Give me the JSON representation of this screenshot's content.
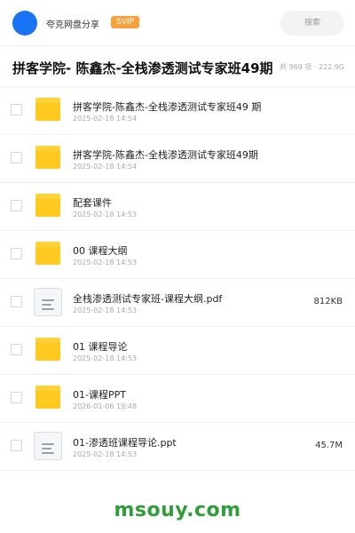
{
  "header": {
    "share_name": "夸克网盘分享",
    "badge": "SVIP",
    "search_label": "搜索",
    "colors": {
      "avatar": "#1a73f5",
      "badge": "#f9a23c"
    }
  },
  "share": {
    "title": "拼客学院- 陈鑫杰-全栈渗透测试专家班49期",
    "meta": "共 969 项 · 222.9G"
  },
  "files": [
    {
      "type": "folder",
      "icon": "folder-icon",
      "name": "拼客学院-陈鑫杰-全栈渗透测试专家班49 期",
      "date": "2025-02-18 14:54",
      "size": ""
    },
    {
      "type": "folder",
      "icon": "folder-icon",
      "name": "拼客学院-陈鑫杰-全栈渗透测试专家班49期",
      "date": "2025-02-18 14:54",
      "size": ""
    },
    {
      "type": "folder",
      "icon": "folder-icon",
      "name": "配套课件",
      "date": "2025-02-18 14:53",
      "size": ""
    },
    {
      "type": "folder",
      "icon": "folder-icon",
      "name": "00 课程大纲",
      "date": "2025-02-18 14:53",
      "size": ""
    },
    {
      "type": "file",
      "icon": "document-icon",
      "name": "全栈渗透测试专家班-课程大纲.pdf",
      "date": "2025-02-18 14:53",
      "size": "812KB"
    },
    {
      "type": "folder",
      "icon": "folder-icon",
      "name": "01 课程导论",
      "date": "2025-02-18 14:53",
      "size": ""
    },
    {
      "type": "folder",
      "icon": "folder-icon",
      "name": "01-课程PPT",
      "date": "2026-01-06 19:48",
      "size": ""
    },
    {
      "type": "file",
      "icon": "document-icon",
      "name": "01-渗透班课程导论.ppt",
      "date": "2025-02-18 14:53",
      "size": "45.7M"
    }
  ],
  "watermark": "msouy.com"
}
